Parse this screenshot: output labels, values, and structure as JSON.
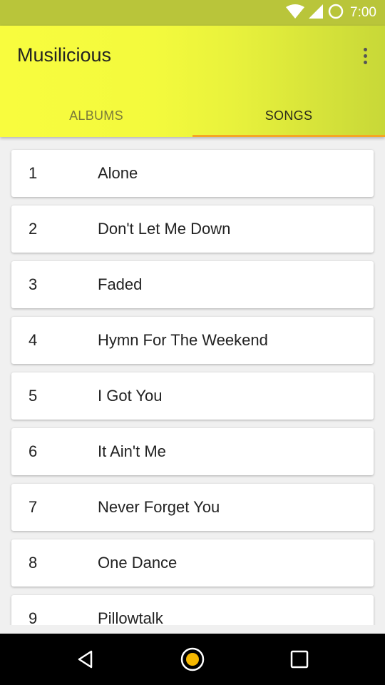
{
  "status_bar": {
    "time": "7:00",
    "icons": [
      "wifi-icon",
      "cell-signal-icon",
      "battery-icon"
    ]
  },
  "app": {
    "title": "Musilicious",
    "overflow_icon": "more-vert-icon"
  },
  "tabs": [
    {
      "label": "ALBUMS",
      "selected": false
    },
    {
      "label": "SONGS",
      "selected": true
    }
  ],
  "songs": [
    {
      "number": "1",
      "title": "Alone"
    },
    {
      "number": "2",
      "title": "Don't Let Me Down"
    },
    {
      "number": "3",
      "title": "Faded"
    },
    {
      "number": "4",
      "title": "Hymn For The Weekend"
    },
    {
      "number": "5",
      "title": "I Got You"
    },
    {
      "number": "6",
      "title": "It Ain't Me"
    },
    {
      "number": "7",
      "title": "Never Forget You"
    },
    {
      "number": "8",
      "title": "One Dance"
    },
    {
      "number": "9",
      "title": "Pillowtalk"
    }
  ],
  "nav_bar": {
    "icons": [
      "back-icon",
      "home-icon",
      "recents-icon"
    ]
  },
  "colors": {
    "status_bar": "#b9c53a",
    "app_bar_start": "#f8fc3e",
    "app_bar_end": "#c8d838",
    "tab_indicator": "#f5a623",
    "home_accent": "#f5b700"
  }
}
